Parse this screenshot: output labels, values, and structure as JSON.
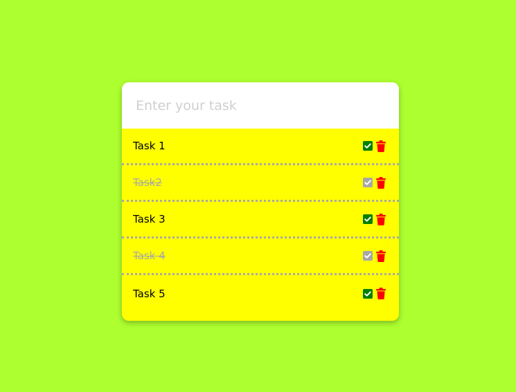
{
  "input": {
    "placeholder": "Enter your task",
    "value": ""
  },
  "tasks": [
    {
      "label": "Task 1",
      "done": false
    },
    {
      "label": "Task2",
      "done": true
    },
    {
      "label": "Task 3",
      "done": false
    },
    {
      "label": "Task 4",
      "done": true
    },
    {
      "label": "Task 5",
      "done": false
    }
  ],
  "icons": {
    "check": "check-square-icon",
    "delete": "trash-icon"
  },
  "colors": {
    "background": "#adff2f",
    "list_background": "#ffff00",
    "check_active": "#008000",
    "check_done": "#a7a7a7",
    "trash": "#ff0000",
    "done_text": "#a7a7a7"
  }
}
